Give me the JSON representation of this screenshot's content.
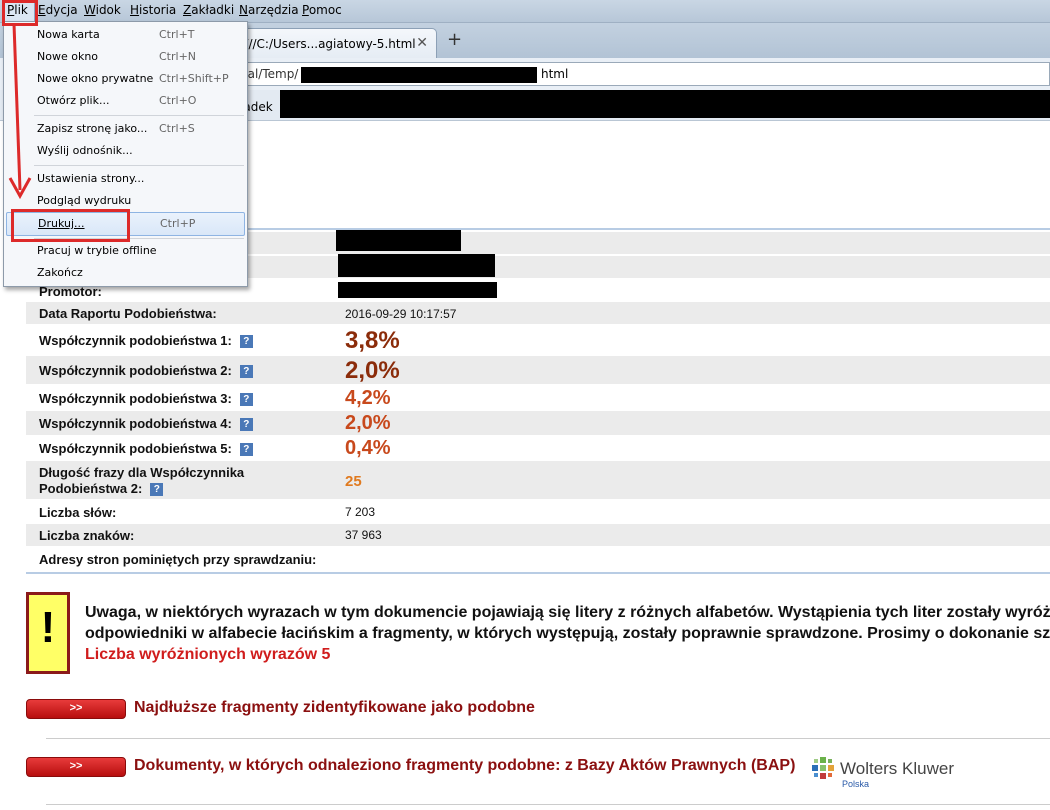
{
  "menubar": {
    "items": [
      {
        "first": "P",
        "rest": "lik"
      },
      {
        "first": "E",
        "rest": "dycja"
      },
      {
        "first": "W",
        "rest": "idok"
      },
      {
        "first": "H",
        "rest": "istoria"
      },
      {
        "first": "Z",
        "rest": "akładki"
      },
      {
        "first": "N",
        "rest": "arzędzia"
      },
      {
        "first": "P",
        "rest": "omoc"
      }
    ]
  },
  "tab": {
    "title": "e:///C:/Users...agiatowy-5.html",
    "close_glyph": "✕",
    "new_tab_glyph": "+"
  },
  "address": {
    "prefix": "cal/Temp/",
    "suffix": "html"
  },
  "bookmarks": {
    "label": "ładek"
  },
  "file_menu": {
    "items": [
      {
        "label": "Nowa karta",
        "shortcut": "Ctrl+T"
      },
      {
        "label": "Nowe okno",
        "shortcut": "Ctrl+N"
      },
      {
        "label": "Nowe okno prywatne",
        "shortcut": "Ctrl+Shift+P"
      },
      {
        "label": "Otwórz plik...",
        "shortcut": "Ctrl+O"
      },
      {
        "label": "Zapisz stronę jako...",
        "shortcut": "Ctrl+S"
      },
      {
        "label": "Wyślij odnośnik...",
        "shortcut": ""
      },
      {
        "label": "Ustawienia strony...",
        "shortcut": ""
      },
      {
        "label": "Podgląd wydruku",
        "shortcut": ""
      },
      {
        "label": "Drukuj...",
        "shortcut": "Ctrl+P"
      },
      {
        "label": "Pracuj w trybie offline",
        "shortcut": ""
      },
      {
        "label": "Zakończ",
        "shortcut": ""
      }
    ],
    "highlighted": "Drukuj..."
  },
  "report": {
    "promotor_label": "Promotor:",
    "date_label": "Data Raportu Podobieństwa:",
    "date_value": "2016-09-29 10:17:57",
    "coefficients": [
      {
        "label": "Współczynnik podobieństwa 1:",
        "value": "3,8%"
      },
      {
        "label": "Współczynnik podobieństwa 2:",
        "value": "2,0%"
      },
      {
        "label": "Współczynnik podobieństwa 3:",
        "value": "4,2%"
      },
      {
        "label": "Współczynnik podobieństwa 4:",
        "value": "2,0%"
      },
      {
        "label": "Współczynnik podobieństwa 5:",
        "value": "0,4%"
      }
    ],
    "help_glyph": "?",
    "phrase_label_1": "Długość frazy dla Współczynnika",
    "phrase_label_2": "Podobieństwa 2:",
    "phrase_value": "25",
    "words_label": "Liczba słów:",
    "words_value": "7 203",
    "chars_label": "Liczba znaków:",
    "chars_value": "37 963",
    "skipped_label": "Adresy stron pominiętych przy sprawdzaniu:"
  },
  "warning": {
    "icon": "!",
    "line1": "Uwaga, w niektórych wyrazach w tym dokumencie pojawiają się litery z różnych alfabetów. Wystąpienia tych liter zostały wyróż",
    "line2": "odpowiedniki w alfabecie łacińskim a fragmenty, w których występują, zostały poprawnie sprawdzone. Prosimy o dokonanie sz",
    "count": "Liczba wyróżnionych wyrazów 5"
  },
  "sections": [
    {
      "button": ">>",
      "title": "Najdłuższe fragmenty zidentyfikowane jako podobne"
    },
    {
      "button": ">>",
      "title": "Dokumenty, w których odnaleziono fragmenty podobne: z Bazy Aktów Prawnych (BAP)"
    }
  ],
  "logo": {
    "name": "Wolters Kluwer",
    "sub": "Polska"
  }
}
